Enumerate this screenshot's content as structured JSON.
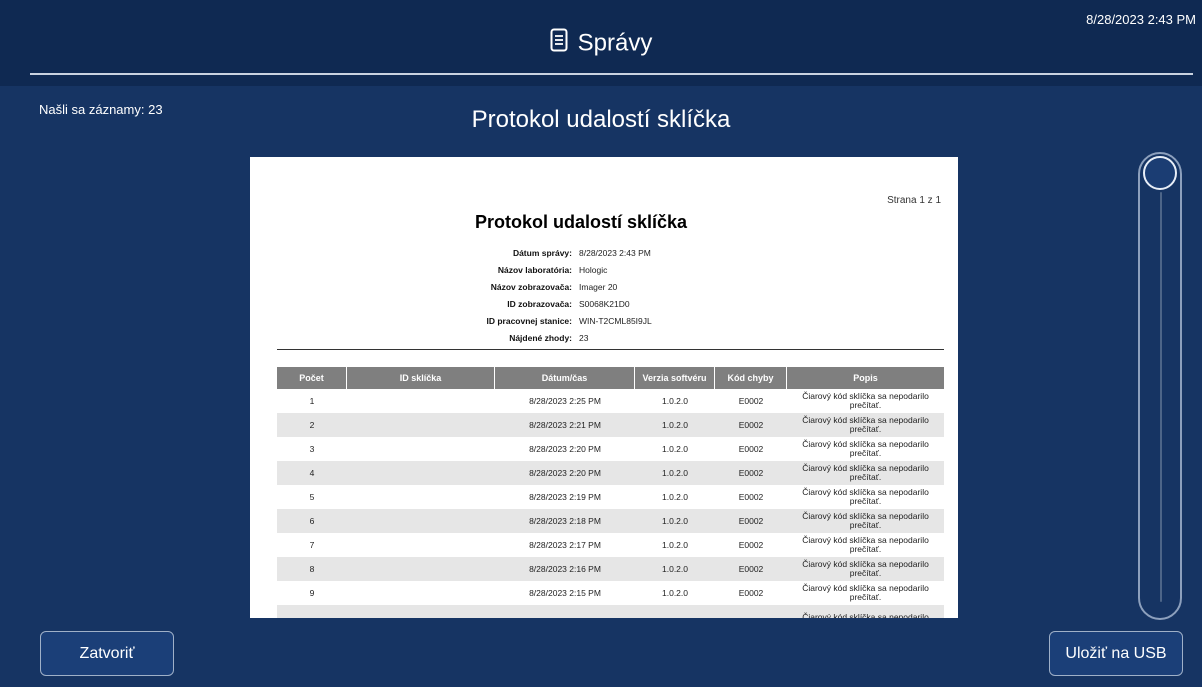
{
  "header": {
    "title": "Správy",
    "icon": "document-list-icon",
    "datetime": "8/28/2023 2:43 PM"
  },
  "records_found": "Našli sa záznamy: 23",
  "page_title": "Protokol udalostí sklíčka",
  "report": {
    "page": "Strana 1 z 1",
    "title": "Protokol udalostí sklíčka",
    "meta": [
      {
        "label": "Dátum správy:",
        "value": "8/28/2023 2:43 PM"
      },
      {
        "label": "Názov laboratória:",
        "value": "Hologic"
      },
      {
        "label": "Názov zobrazovača:",
        "value": "Imager 20"
      },
      {
        "label": "ID zobrazovača:",
        "value": "S0068K21D0"
      },
      {
        "label": "ID pracovnej stanice:",
        "value": "WIN-T2CML85I9JL"
      },
      {
        "label": "Nájdené zhody:",
        "value": "23"
      }
    ],
    "columns": [
      "Počet",
      "ID sklíčka",
      "Dátum/čas",
      "Verzia softvéru",
      "Kód chyby",
      "Popis"
    ],
    "rows": [
      {
        "count": "1",
        "slide_id": "",
        "datetime": "8/28/2023 2:25 PM",
        "version": "1.0.2.0",
        "code": "E0002",
        "desc1": "Čiarový kód sklíčka sa nepodarilo",
        "desc2": "prečítať."
      },
      {
        "count": "2",
        "slide_id": "",
        "datetime": "8/28/2023 2:21 PM",
        "version": "1.0.2.0",
        "code": "E0002",
        "desc1": "Čiarový kód sklíčka sa nepodarilo",
        "desc2": "prečítať."
      },
      {
        "count": "3",
        "slide_id": "",
        "datetime": "8/28/2023 2:20 PM",
        "version": "1.0.2.0",
        "code": "E0002",
        "desc1": "Čiarový kód sklíčka sa nepodarilo",
        "desc2": "prečítať."
      },
      {
        "count": "4",
        "slide_id": "",
        "datetime": "8/28/2023 2:20 PM",
        "version": "1.0.2.0",
        "code": "E0002",
        "desc1": "Čiarový kód sklíčka sa nepodarilo",
        "desc2": "prečítať."
      },
      {
        "count": "5",
        "slide_id": "",
        "datetime": "8/28/2023 2:19 PM",
        "version": "1.0.2.0",
        "code": "E0002",
        "desc1": "Čiarový kód sklíčka sa nepodarilo",
        "desc2": "prečítať."
      },
      {
        "count": "6",
        "slide_id": "",
        "datetime": "8/28/2023 2:18 PM",
        "version": "1.0.2.0",
        "code": "E0002",
        "desc1": "Čiarový kód sklíčka sa nepodarilo",
        "desc2": "prečítať."
      },
      {
        "count": "7",
        "slide_id": "",
        "datetime": "8/28/2023 2:17 PM",
        "version": "1.0.2.0",
        "code": "E0002",
        "desc1": "Čiarový kód sklíčka sa nepodarilo",
        "desc2": "prečítať."
      },
      {
        "count": "8",
        "slide_id": "",
        "datetime": "8/28/2023 2:16 PM",
        "version": "1.0.2.0",
        "code": "E0002",
        "desc1": "Čiarový kód sklíčka sa nepodarilo",
        "desc2": "prečítať."
      },
      {
        "count": "9",
        "slide_id": "",
        "datetime": "8/28/2023 2:15 PM",
        "version": "1.0.2.0",
        "code": "E0002",
        "desc1": "Čiarový kód sklíčka sa nepodarilo",
        "desc2": "prečítať."
      },
      {
        "count": "",
        "slide_id": "",
        "datetime": "",
        "version": "",
        "code": "",
        "desc1": "Čiarový kód sklíčka sa nepodarilo",
        "desc2": ""
      }
    ]
  },
  "scroll": {
    "position": 0
  },
  "buttons": {
    "close": "Zatvoriť",
    "save_usb": "Uložiť na USB"
  },
  "colors": {
    "background": "#163463",
    "header": "#0f2952",
    "table_header": "#7f7f7f",
    "row_alt": "#e6e6e6"
  }
}
